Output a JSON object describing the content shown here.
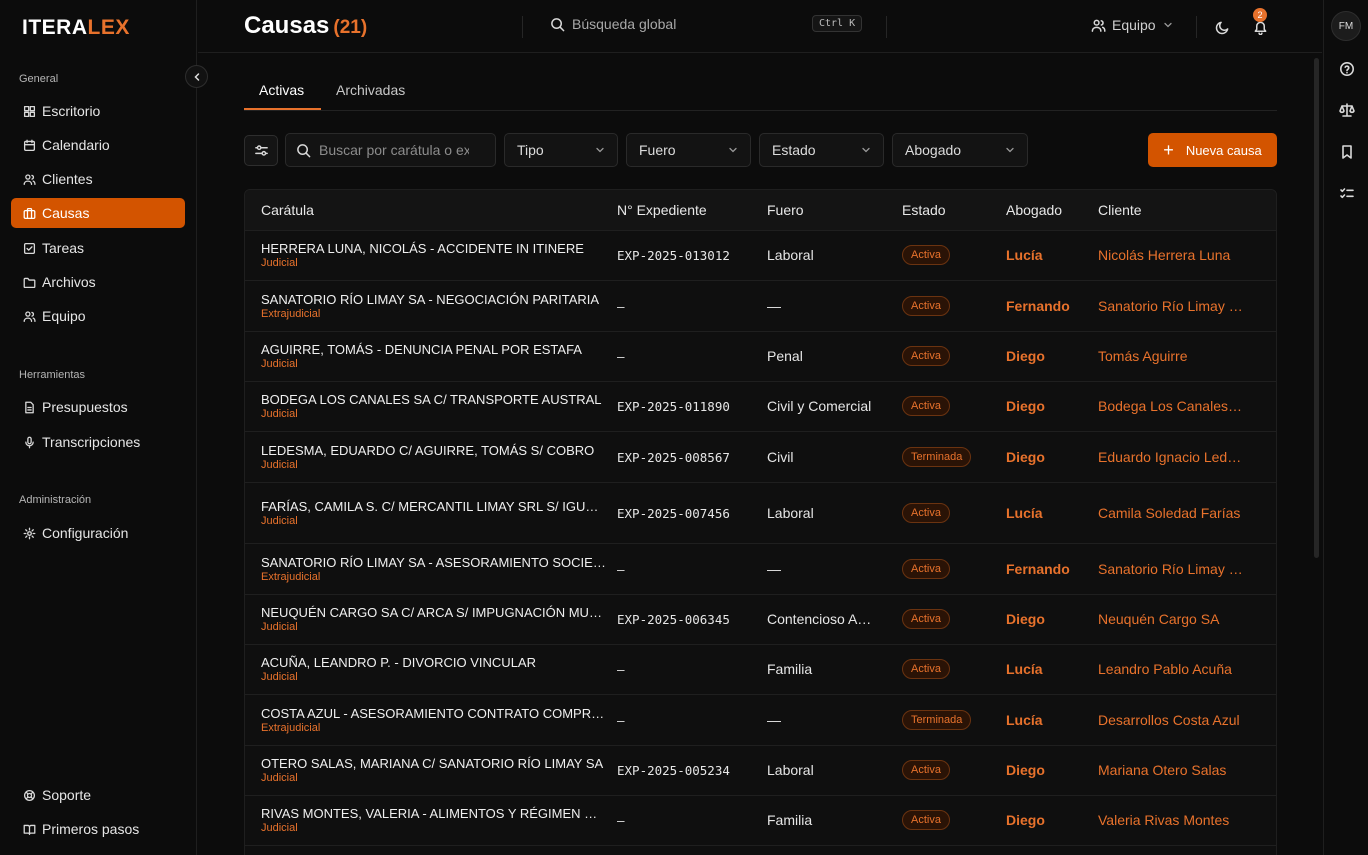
{
  "app": {
    "logo_left": "ITERA",
    "logo_right": "LEX"
  },
  "sidebar": {
    "sections": [
      {
        "label": "General"
      },
      {
        "label": "Herramientas"
      },
      {
        "label": "Administración"
      }
    ],
    "items": [
      {
        "label": "Escritorio",
        "icon": "grid-icon"
      },
      {
        "label": "Calendario",
        "icon": "calendar-icon"
      },
      {
        "label": "Clientes",
        "icon": "users-icon"
      },
      {
        "label": "Causas",
        "icon": "briefcase-icon",
        "active": true
      },
      {
        "label": "Tareas",
        "icon": "checkbox-icon"
      },
      {
        "label": "Archivos",
        "icon": "folder-icon"
      },
      {
        "label": "Equipo",
        "icon": "team-icon"
      },
      {
        "label": "Presupuestos",
        "icon": "document-icon"
      },
      {
        "label": "Transcripciones",
        "icon": "microphone-icon"
      },
      {
        "label": "Configuración",
        "icon": "gear-icon"
      },
      {
        "label": "Soporte",
        "icon": "lifebuoy-icon"
      },
      {
        "label": "Primeros pasos",
        "icon": "book-icon"
      }
    ]
  },
  "header": {
    "title": "Causas",
    "count": "(21)",
    "search_placeholder": "Búsqueda global",
    "shortcut": "Ctrl K",
    "team_label": "Equipo",
    "notifications": "2"
  },
  "rail": {
    "avatar": "FM"
  },
  "tabs": [
    {
      "label": "Activas",
      "active": true
    },
    {
      "label": "Archivadas"
    }
  ],
  "filters": {
    "search_placeholder": "Buscar por carátula o expediente",
    "tipo": "Tipo",
    "fuero": "Fuero",
    "estado": "Estado",
    "abogado": "Abogado",
    "new_button": "Nueva causa"
  },
  "table": {
    "columns": [
      "Carátula",
      "N° Expediente",
      "Fuero",
      "Estado",
      "Abogado",
      "Cliente"
    ],
    "rows": [
      {
        "caratula": "HERRERA LUNA, NICOLÁS - ACCIDENTE IN ITINERE",
        "tipo": "Judicial",
        "expediente": "EXP-2025-013012",
        "fuero": "Laboral",
        "estado": "Activa",
        "abogado": "Lucía",
        "cliente": "Nicolás Herrera Luna"
      },
      {
        "caratula": "SANATORIO RÍO LIMAY SA - NEGOCIACIÓN PARITARIA",
        "tipo": "Extrajudicial",
        "expediente": "–",
        "fuero": "—",
        "estado": "Activa",
        "abogado": "Fernando",
        "cliente": "Sanatorio Río Limay SA"
      },
      {
        "caratula": "AGUIRRE, TOMÁS - DENUNCIA PENAL POR ESTAFA",
        "tipo": "Judicial",
        "expediente": "–",
        "fuero": "Penal",
        "estado": "Activa",
        "abogado": "Diego",
        "cliente": "Tomás Aguirre"
      },
      {
        "caratula": "BODEGA LOS CANALES SA C/ TRANSPORTE AUSTRAL",
        "tipo": "Judicial",
        "expediente": "EXP-2025-011890",
        "fuero": "Civil y Comercial",
        "estado": "Activa",
        "abogado": "Diego",
        "cliente": "Bodega Los Canales SA"
      },
      {
        "caratula": "LEDESMA, EDUARDO C/ AGUIRRE, TOMÁS S/ COBRO",
        "tipo": "Judicial",
        "expediente": "EXP-2025-008567",
        "fuero": "Civil",
        "estado": "Terminada",
        "abogado": "Diego",
        "cliente": "Eduardo Ignacio Ledesma"
      },
      {
        "caratula": "FARÍAS, CAMILA S. C/ MERCANTIL LIMAY SRL S/ IGUALDAD",
        "tipo": "Judicial",
        "expediente": "EXP-2025-007456",
        "fuero": "Laboral",
        "estado": "Activa",
        "abogado": "Lucía",
        "cliente": "Camila Soledad Farías"
      },
      {
        "caratula": "SANATORIO RÍO LIMAY SA - ASESORAMIENTO SOCIETARIO",
        "tipo": "Extrajudicial",
        "expediente": "–",
        "fuero": "—",
        "estado": "Activa",
        "abogado": "Fernando",
        "cliente": "Sanatorio Río Limay SA"
      },
      {
        "caratula": "NEUQUÉN CARGO SA C/ ARCA S/ IMPUGNACIÓN MULTA",
        "tipo": "Judicial",
        "expediente": "EXP-2025-006345",
        "fuero": "Contencioso Administrativo",
        "estado": "Activa",
        "abogado": "Diego",
        "cliente": "Neuquén Cargo SA"
      },
      {
        "caratula": "ACUÑA, LEANDRO P. - DIVORCIO VINCULAR",
        "tipo": "Judicial",
        "expediente": "–",
        "fuero": "Familia",
        "estado": "Activa",
        "abogado": "Lucía",
        "cliente": "Leandro Pablo Acuña"
      },
      {
        "caratula": "COSTA AZUL - ASESORAMIENTO CONTRATO COMPRAVENTA",
        "tipo": "Extrajudicial",
        "expediente": "–",
        "fuero": "—",
        "estado": "Terminada",
        "abogado": "Lucía",
        "cliente": "Desarrollos Costa Azul"
      },
      {
        "caratula": "OTERO SALAS, MARIANA C/ SANATORIO RÍO LIMAY SA",
        "tipo": "Judicial",
        "expediente": "EXP-2025-005234",
        "fuero": "Laboral",
        "estado": "Activa",
        "abogado": "Diego",
        "cliente": "Mariana Otero Salas"
      },
      {
        "caratula": "RIVAS MONTES, VALERIA - ALIMENTOS Y RÉGIMEN DE VISITAS",
        "tipo": "Judicial",
        "expediente": "–",
        "fuero": "Familia",
        "estado": "Activa",
        "abogado": "Diego",
        "cliente": "Valeria Rivas Montes"
      }
    ]
  },
  "colors": {
    "accent": "#d35400",
    "accent_text": "#e8722c",
    "background": "#0c0c0c"
  }
}
